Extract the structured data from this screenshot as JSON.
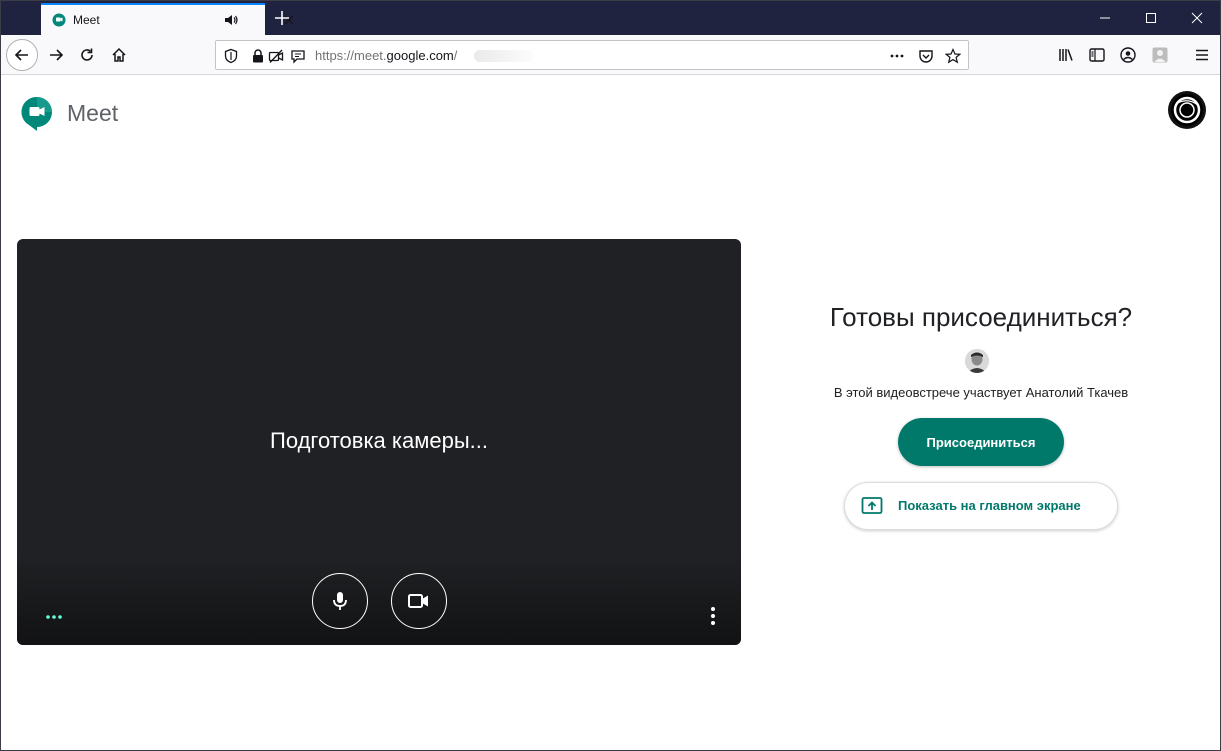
{
  "browser": {
    "tab": {
      "title": "Meet"
    },
    "url": {
      "scheme": "https://meet.",
      "host": "google.com",
      "path": "/"
    }
  },
  "header": {
    "app_name": "Meet"
  },
  "preview": {
    "status_text": "Подготовка камеры..."
  },
  "join": {
    "title": "Готовы присоединиться?",
    "participants_text": "В этой видеовстрече участвует Анатолий Ткачев",
    "join_label": "Присоединиться",
    "present_label": "Показать на главном экране"
  },
  "colors": {
    "accent": "#00796b",
    "preview_bg": "#202124",
    "tabstrip_bg": "#202340"
  },
  "icons": [
    "meet-logo",
    "microphone-icon",
    "camera-icon",
    "more-vert-icon",
    "present-icon"
  ]
}
